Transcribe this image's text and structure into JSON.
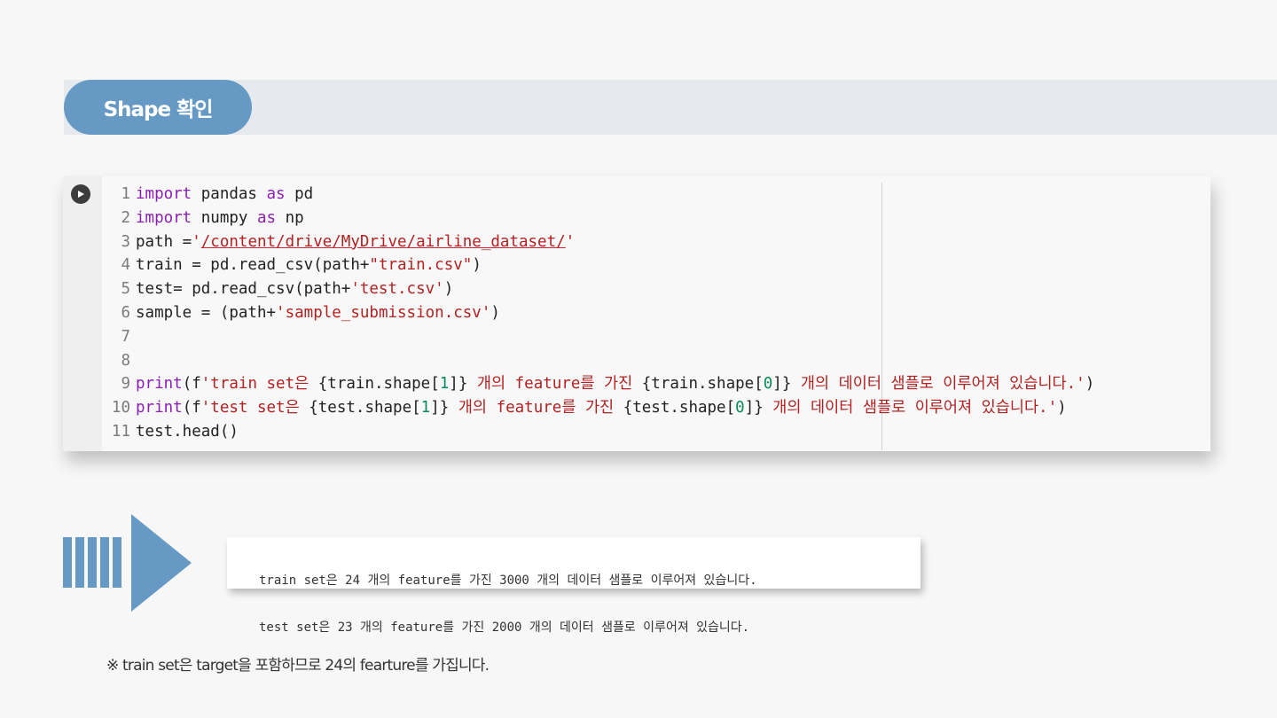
{
  "header": {
    "title": "Shape 확인"
  },
  "code_cell": {
    "lines": [
      {
        "n": "1",
        "parts": [
          {
            "t": "import",
            "c": "kw"
          },
          {
            "t": " pandas "
          },
          {
            "t": "as",
            "c": "kw"
          },
          {
            "t": " pd"
          }
        ]
      },
      {
        "n": "2",
        "parts": [
          {
            "t": "import",
            "c": "kw"
          },
          {
            "t": " numpy "
          },
          {
            "t": "as",
            "c": "kw"
          },
          {
            "t": " np"
          }
        ]
      },
      {
        "n": "3",
        "parts": [
          {
            "t": "path ="
          },
          {
            "t": "'",
            "c": "str"
          },
          {
            "t": "/content/drive/MyDrive/airline_dataset/",
            "c": "str ul"
          },
          {
            "t": "'",
            "c": "str"
          }
        ]
      },
      {
        "n": "4",
        "parts": [
          {
            "t": "train = pd.read_csv(path+"
          },
          {
            "t": "\"train.csv\"",
            "c": "str"
          },
          {
            "t": ")"
          }
        ]
      },
      {
        "n": "5",
        "parts": [
          {
            "t": "test= pd.read_csv(path+"
          },
          {
            "t": "'test.csv'",
            "c": "str"
          },
          {
            "t": ")"
          }
        ]
      },
      {
        "n": "6",
        "parts": [
          {
            "t": "sample = (path+"
          },
          {
            "t": "'sample_submission.csv'",
            "c": "str"
          },
          {
            "t": ")"
          }
        ]
      },
      {
        "n": "7",
        "parts": []
      },
      {
        "n": "8",
        "parts": []
      },
      {
        "n": "9",
        "parts": [
          {
            "t": "print",
            "c": "fn"
          },
          {
            "t": "(f"
          },
          {
            "t": "'train set은 ",
            "c": "str"
          },
          {
            "t": "{train.shape["
          },
          {
            "t": "1",
            "c": "num"
          },
          {
            "t": "]}"
          },
          {
            "t": " 개의 feature를 가진 ",
            "c": "str"
          },
          {
            "t": "{train.shape["
          },
          {
            "t": "0",
            "c": "num"
          },
          {
            "t": "]}"
          },
          {
            "t": " 개의 데이터 샘플로 이루어져 있습니다.'",
            "c": "str"
          },
          {
            "t": ")"
          }
        ]
      },
      {
        "n": "10",
        "parts": [
          {
            "t": "print",
            "c": "fn"
          },
          {
            "t": "(f"
          },
          {
            "t": "'test set은 ",
            "c": "str"
          },
          {
            "t": "{test.shape["
          },
          {
            "t": "1",
            "c": "num"
          },
          {
            "t": "]}"
          },
          {
            "t": " 개의 feature를 가진 ",
            "c": "str"
          },
          {
            "t": "{test.shape["
          },
          {
            "t": "0",
            "c": "num"
          },
          {
            "t": "]}"
          },
          {
            "t": " 개의 데이터 샘플로 이루어져 있습니다.'",
            "c": "str"
          },
          {
            "t": ")"
          }
        ]
      },
      {
        "n": "11",
        "parts": [
          {
            "t": "test.head()"
          }
        ]
      }
    ]
  },
  "output": {
    "lines": [
      "train set은 24 개의 feature를 가진 3000 개의 데이터 샘플로 이루어져 있습니다.",
      "test set은 23 개의 feature를 가진 2000 개의 데이터 샘플로 이루어져 있습니다."
    ]
  },
  "note": "※ train set은 target을 포함하므로 24의 fearture를 가집니다.",
  "colors": {
    "accent": "#6699c4",
    "band": "#e6eaee",
    "keyword": "#8b1fb0",
    "string": "#b22222",
    "number": "#0b8a5a"
  },
  "icons": {
    "run": "play-circle-icon",
    "arrow": "arrow-right-icon"
  }
}
